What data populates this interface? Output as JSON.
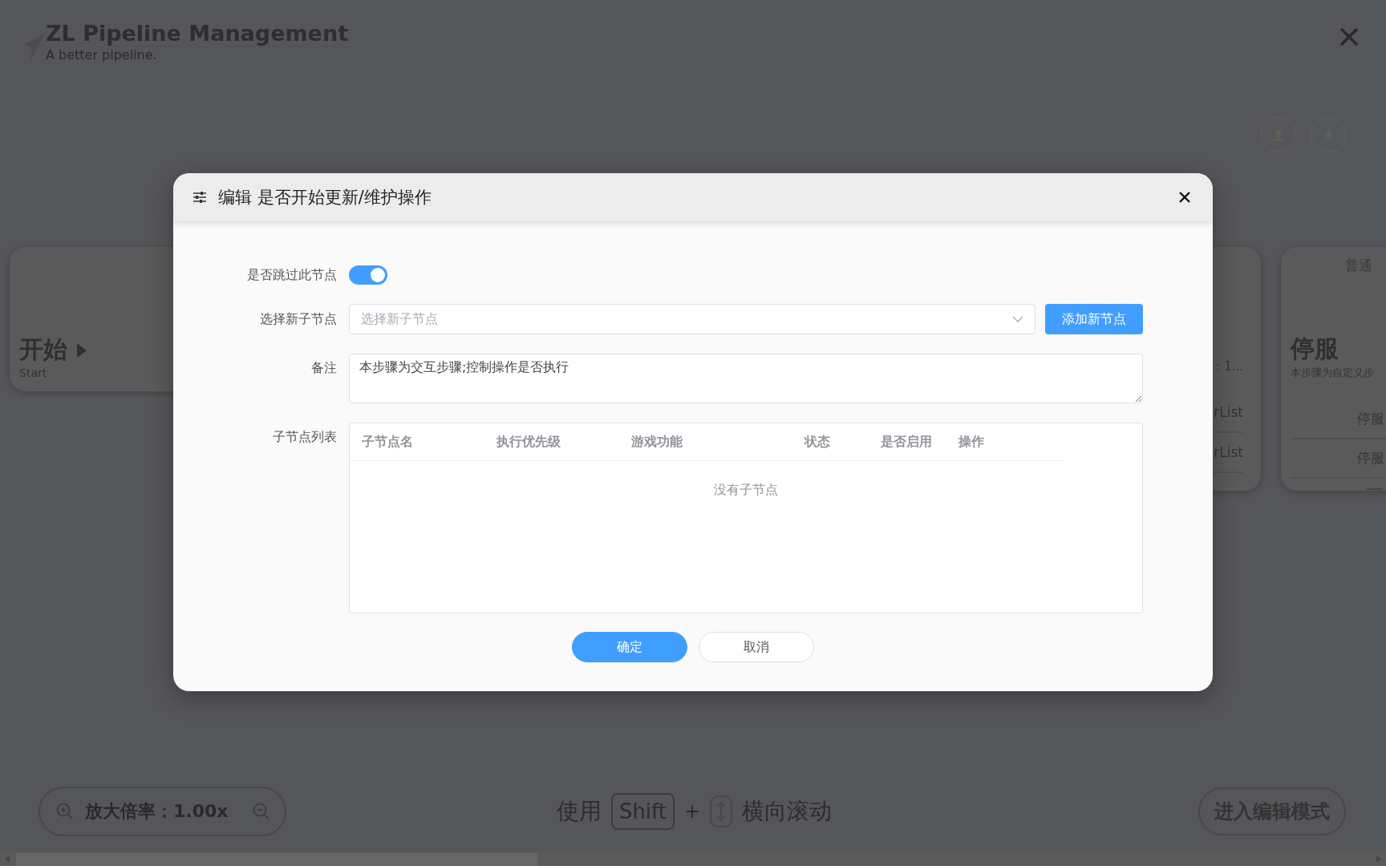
{
  "app": {
    "title": "ZL Pipeline Management",
    "subtitle": "A better pipeline."
  },
  "canvas": {
    "nodes": [
      {
        "kind": "start",
        "title": "开始",
        "subtitle": "Start"
      },
      {
        "kind": "partial",
        "lines": [
          "：1...",
          "rList",
          "rList"
        ]
      },
      {
        "kind": "normal",
        "type_label": "普通",
        "title": "停服",
        "description": "本步骤为自定义步",
        "rows": [
          "停服",
          "停服"
        ]
      }
    ]
  },
  "dialog": {
    "title": "编辑 是否开始更新/维护操作",
    "fields": [
      {
        "kind": "switch",
        "label": "是否跳过此节点",
        "on": true
      },
      {
        "kind": "select",
        "label": "选择新子节点",
        "placeholder": "选择新子节点",
        "button": "添加新节点"
      },
      {
        "kind": "textarea",
        "label": "备注",
        "value": "本步骤为交互步骤;控制操作是否执行"
      },
      {
        "kind": "table",
        "label": "子节点列表",
        "columns": [
          "子节点名",
          "执行优先级",
          "游戏功能",
          "状态",
          "是否启用",
          "操作"
        ],
        "empty_text": "没有子节点"
      }
    ],
    "buttons": [
      {
        "kind": "primary",
        "label": "确定"
      },
      {
        "kind": "default",
        "label": "取消"
      }
    ]
  },
  "footer": {
    "zoom_label": "放大倍率：1.00x",
    "hint_before": "使用",
    "hint_key": "Shift",
    "hint_plus": "+",
    "hint_after": "横向滚动",
    "edit_button": "进入编辑模式"
  }
}
